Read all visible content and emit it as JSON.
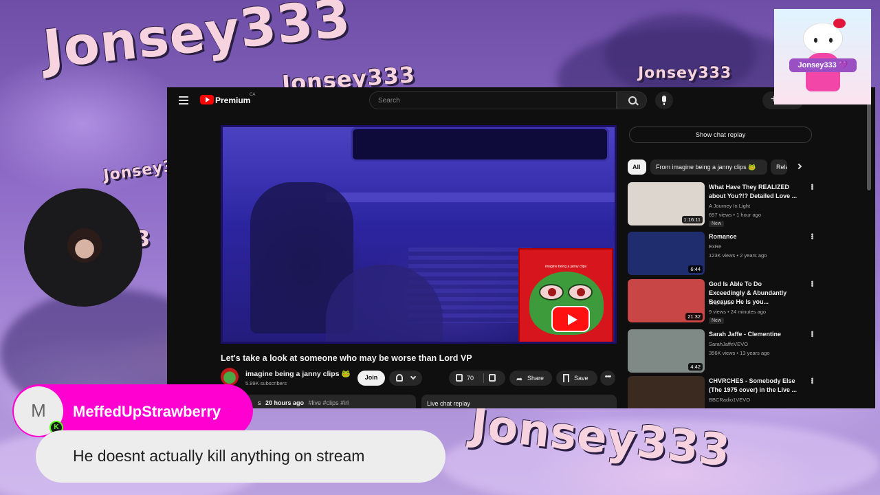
{
  "watermarks": {
    "top_left": "Jonsey333",
    "top_mid": "Jonsey333",
    "top_right": "Jonsey333",
    "side": "Jonsey333",
    "bottom_right": "Jonsey333",
    "peek": "3"
  },
  "youtube": {
    "header": {
      "brand": "Premium",
      "region": "CA",
      "search_placeholder": "Search",
      "create_label": "+"
    },
    "video": {
      "thumb_text": "imagine being a janny clips",
      "title": "Let's take a look at someone who may be worse than Lord VP",
      "channel": "imagine being a janny clips 🐸",
      "subscribers": "5.99K subscribers",
      "join_label": "Join",
      "likes": "70",
      "share_label": "Share",
      "save_label": "Save",
      "more_label": "•••",
      "description_partial": "s",
      "description_time": "20 hours ago",
      "description_tags": "#live #clips #irl",
      "live_chat_label": "Live chat replay"
    },
    "sidebar": {
      "chat_replay_button": "Show chat replay",
      "chips": [
        "All",
        "From imagine being a janny clips 🐸",
        "Rela"
      ],
      "recommendations": [
        {
          "title": "What Have They REALIZED about You?!? Detailed Love ...",
          "channel": "A Journey In Light",
          "meta": "697 views • 1 hour ago",
          "badge": "New",
          "duration": "1:16:11",
          "thumb_color": "#dcd6cf"
        },
        {
          "title": "Romance",
          "channel": "ExRe",
          "meta": "123K views • 2 years ago",
          "badge": "",
          "duration": "6:44",
          "thumb_color": "#1f2c6e"
        },
        {
          "title": "God Is Able To Do Exceedingly & Abundantly Because He Is you...",
          "channel": "Wild Spirit",
          "meta": "9 views • 24 minutes ago",
          "badge": "New",
          "duration": "21:32",
          "thumb_color": "#c94646"
        },
        {
          "title": "Sarah Jaffe - Clementine",
          "channel": "SarahJaffeVEVO",
          "meta": "356K views • 13 years ago",
          "badge": "",
          "duration": "4:42",
          "thumb_color": "#7f8a86"
        },
        {
          "title": "CHVRCHES - Somebody Else (The 1975 cover) in the Live ...",
          "channel": "BBCRadio1VEVO",
          "meta": "",
          "badge": "",
          "duration": "",
          "thumb_color": "#3a2a1f"
        }
      ]
    }
  },
  "overlay": {
    "badge_name": "Jonsey333 💜",
    "chat": {
      "avatar_letter": "M",
      "platform_badge": "K",
      "username": "MeffedUpStrawberry",
      "message": "He doesnt actually kill anything on stream"
    }
  },
  "colors": {
    "chat_name_bg": "#ff00d0",
    "kick_green": "#53fc18",
    "youtube_red": "#ff0000"
  }
}
